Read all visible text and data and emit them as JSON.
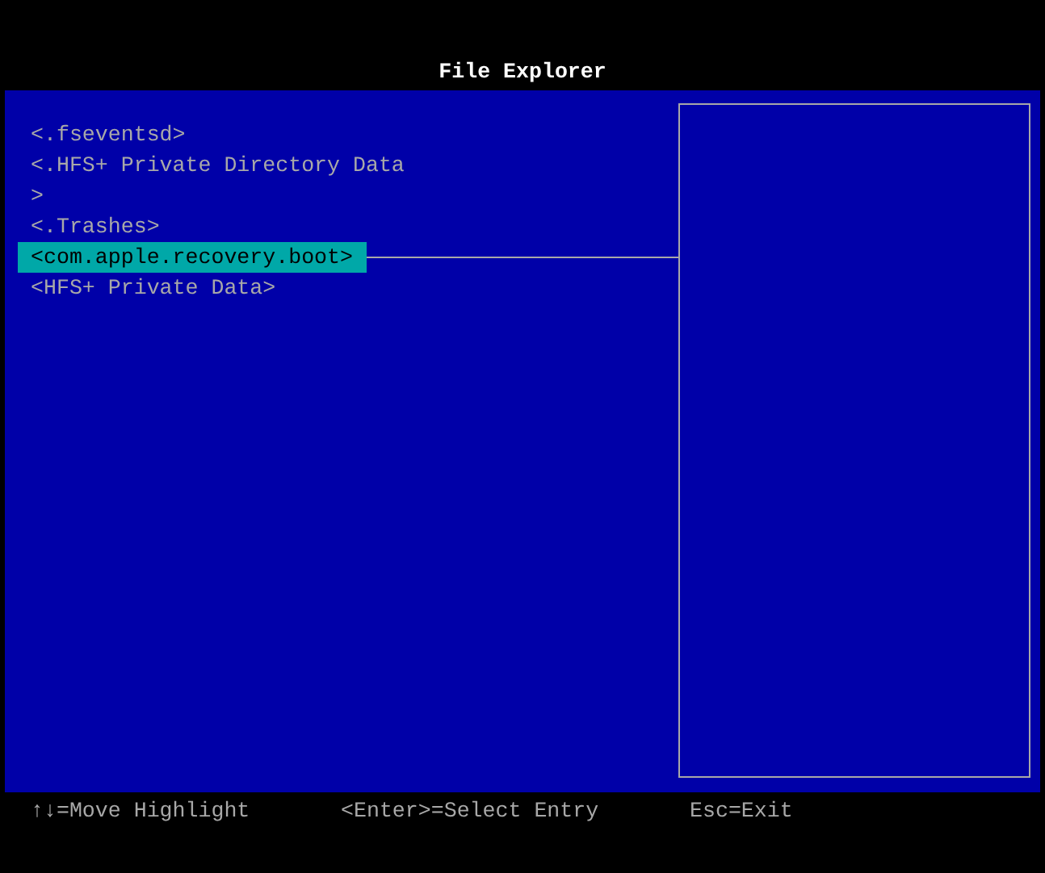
{
  "window": {
    "title": "File Explorer"
  },
  "entries": [
    {
      "label": "<.fseventsd>",
      "selected": false
    },
    {
      "label": "<.HFS+ Private Directory Data",
      "selected": false
    },
    {
      "label": ">",
      "selected": false
    },
    {
      "label": "<.Trashes>",
      "selected": false
    },
    {
      "label": "<com.apple.recovery.boot>",
      "selected": true
    },
    {
      "label": "<HFS+ Private Data>",
      "selected": false
    }
  ],
  "status_bar": [
    "↑↓=Move Highlight",
    "<Enter>=Select Entry",
    "Esc=Exit"
  ]
}
